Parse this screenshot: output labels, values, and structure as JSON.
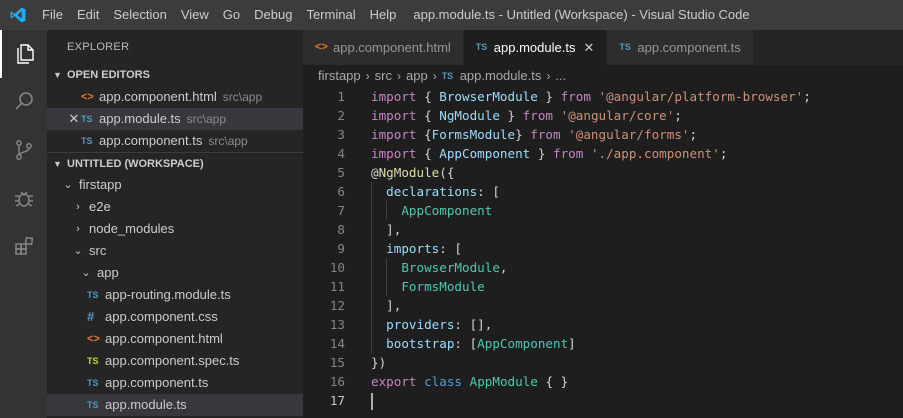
{
  "titlebar": {
    "menu": [
      "File",
      "Edit",
      "Selection",
      "View",
      "Go",
      "Debug",
      "Terminal",
      "Help"
    ],
    "window_title": "app.module.ts - Untitled (Workspace) - Visual Studio Code"
  },
  "activity_bar": {
    "items": [
      {
        "icon": "files-icon",
        "active": true
      },
      {
        "icon": "search-icon",
        "active": false
      },
      {
        "icon": "source-control-icon",
        "active": false
      },
      {
        "icon": "debug-icon",
        "active": false
      },
      {
        "icon": "extensions-icon",
        "active": false
      }
    ]
  },
  "sidebar": {
    "title": "EXPLORER",
    "open_editors": {
      "header": "OPEN EDITORS",
      "items": [
        {
          "icon": "<>",
          "name": "app.component.html",
          "path": "src\\app"
        },
        {
          "icon": "TS",
          "name": "app.module.ts",
          "path": "src\\app",
          "close": "✕"
        },
        {
          "icon": "TS",
          "name": "app.component.ts",
          "path": "src\\app"
        }
      ]
    },
    "workspace": {
      "header": "UNTITLED (WORKSPACE)",
      "tree": [
        {
          "label": "firstapp"
        },
        {
          "label": "e2e"
        },
        {
          "label": "node_modules"
        },
        {
          "label": "src"
        },
        {
          "label": "app"
        },
        {
          "icon": "TS",
          "label": "app-routing.module.ts"
        },
        {
          "icon": "#",
          "label": "app.component.css"
        },
        {
          "icon": "<>",
          "label": "app.component.html"
        },
        {
          "icon": "TS",
          "label": "app.component.spec.ts"
        },
        {
          "icon": "TS",
          "label": "app.component.ts"
        },
        {
          "icon": "TS",
          "label": "app.module.ts"
        }
      ]
    }
  },
  "editor": {
    "tabs": [
      {
        "icon": "<>",
        "label": "app.component.html"
      },
      {
        "icon": "TS",
        "label": "app.module.ts",
        "close": "✕"
      },
      {
        "icon": "TS",
        "label": "app.component.ts"
      }
    ],
    "breadcrumb": [
      "firstapp",
      "src",
      "app",
      "app.module.ts",
      "..."
    ],
    "breadcrumb_icon": "TS",
    "line_numbers": [
      "1",
      "2",
      "3",
      "4",
      "5",
      "6",
      "7",
      "8",
      "9",
      "10",
      "11",
      "12",
      "13",
      "14",
      "15",
      "16",
      "17"
    ],
    "code": {
      "l1": [
        "import",
        " { ",
        "BrowserModule",
        " } ",
        "from",
        " ",
        "'@angular/platform-browser'",
        ";"
      ],
      "l2": [
        "import",
        " { ",
        "NgModule",
        " } ",
        "from",
        " ",
        "'@angular/core'",
        ";"
      ],
      "l3": [
        "import",
        " {",
        "FormsModule",
        "} ",
        "from",
        " ",
        "'@angular/forms'",
        ";"
      ],
      "l4": [
        "import",
        " { ",
        "AppComponent",
        " } ",
        "from",
        " ",
        "'./app.component'",
        ";"
      ],
      "l5": [
        "@",
        "NgModule",
        "({"
      ],
      "l6": [
        "declarations",
        ": ["
      ],
      "l7": [
        "AppComponent"
      ],
      "l8": [
        "],"
      ],
      "l9": [
        "imports",
        ": ["
      ],
      "l10": [
        "BrowserModule",
        ","
      ],
      "l11": [
        "FormsModule"
      ],
      "l12": [
        "],"
      ],
      "l13": [
        "providers",
        ": [],"
      ],
      "l14": [
        "bootstrap",
        ": [",
        "AppComponent",
        "]"
      ],
      "l15": [
        "})"
      ],
      "l16": [
        "export",
        " ",
        "class",
        " ",
        "AppModule",
        " { }"
      ],
      "l17": []
    }
  }
}
